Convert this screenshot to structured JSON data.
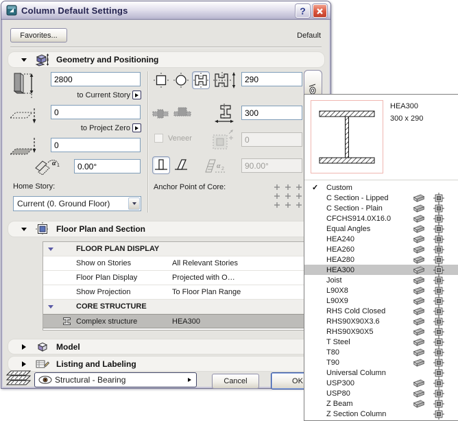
{
  "window": {
    "title": "Column Default Settings",
    "help_glyph": "?"
  },
  "toolbar": {
    "favorites_label": "Favorites...",
    "default_label": "Default"
  },
  "sections": {
    "geometry_title": "Geometry and Positioning",
    "floorplan_title": "Floor Plan and Section",
    "model_title": "Model",
    "listing_title": "Listing and Labeling"
  },
  "geometry": {
    "height_value": "2800",
    "top_link_label": "to Current Story",
    "elevation_value": "0",
    "bottom_link_label": "to Project Zero",
    "offset_value": "0",
    "rotation_value": "0.00°",
    "home_story_label": "Home Story:",
    "home_story_value": "Current (0. Ground Floor)",
    "core_width_value": "290",
    "core_depth_value": "300",
    "veneer_label": "Veneer",
    "veneer_value": "0",
    "slant_value": "90.00°",
    "anchor_label": "Anchor Point of Core:"
  },
  "table": {
    "group1_label": "FLOOR PLAN DISPLAY",
    "row1_name": "Show on Stories",
    "row1_value": "All Relevant Stories",
    "row2_name": "Floor Plan Display",
    "row2_value": "Projected with O…",
    "row3_name": "Show Projection",
    "row3_value": "To Floor Plan Range",
    "group2_label": "CORE STRUCTURE",
    "row4_name": "Complex structure",
    "row4_value": "HEA300"
  },
  "footer": {
    "layer_value": "Structural - Bearing",
    "cancel_label": "Cancel",
    "ok_label": "OK"
  },
  "popup": {
    "preview_name": "HEA300",
    "preview_size": "300 x 290",
    "check_glyph": "✓",
    "items": [
      {
        "label": "Custom",
        "checked": true,
        "beam": false,
        "col": false
      },
      {
        "label": "C Section - Lipped",
        "beam": true,
        "col": true
      },
      {
        "label": "C Section - Plain",
        "beam": true,
        "col": true
      },
      {
        "label": "CFCHS914.0X16.0",
        "beam": true,
        "col": true
      },
      {
        "label": "Equal Angles",
        "beam": true,
        "col": true
      },
      {
        "label": "HEA240",
        "beam": true,
        "col": true
      },
      {
        "label": "HEA260",
        "beam": true,
        "col": true
      },
      {
        "label": "HEA280",
        "beam": true,
        "col": true
      },
      {
        "label": "HEA300",
        "beam": true,
        "col": true,
        "selected": true
      },
      {
        "label": "Joist",
        "beam": true,
        "col": true
      },
      {
        "label": "L90X8",
        "beam": true,
        "col": true
      },
      {
        "label": "L90X9",
        "beam": true,
        "col": true
      },
      {
        "label": "RHS Cold Closed",
        "beam": true,
        "col": true
      },
      {
        "label": "RHS90X90X3.6",
        "beam": true,
        "col": true
      },
      {
        "label": "RHS90X90X5",
        "beam": true,
        "col": true
      },
      {
        "label": "T Steel",
        "beam": true,
        "col": true
      },
      {
        "label": "T80",
        "beam": true,
        "col": true
      },
      {
        "label": "T90",
        "beam": true,
        "col": true
      },
      {
        "label": "Universal Column",
        "beam": false,
        "col": true
      },
      {
        "label": "USP300",
        "beam": true,
        "col": true
      },
      {
        "label": "USP80",
        "beam": true,
        "col": true
      },
      {
        "label": "Z Beam",
        "beam": true,
        "col": true
      },
      {
        "label": "Z Section Column",
        "beam": false,
        "col": true
      }
    ]
  },
  "colors": {
    "body_bg": "#E5E4E0",
    "title_top": "#FFFFFF",
    "title_bottom": "#AAA8C2",
    "input_border": "#7F9DB9",
    "selection_gray": "#BDBCB9",
    "popup_selection": "#C6C6C6",
    "preview_border": "#F0B6B0",
    "close_red": "#D9543C",
    "stories_icon_red": "#CC2222",
    "projection_icon_blue": "#2244CC"
  }
}
